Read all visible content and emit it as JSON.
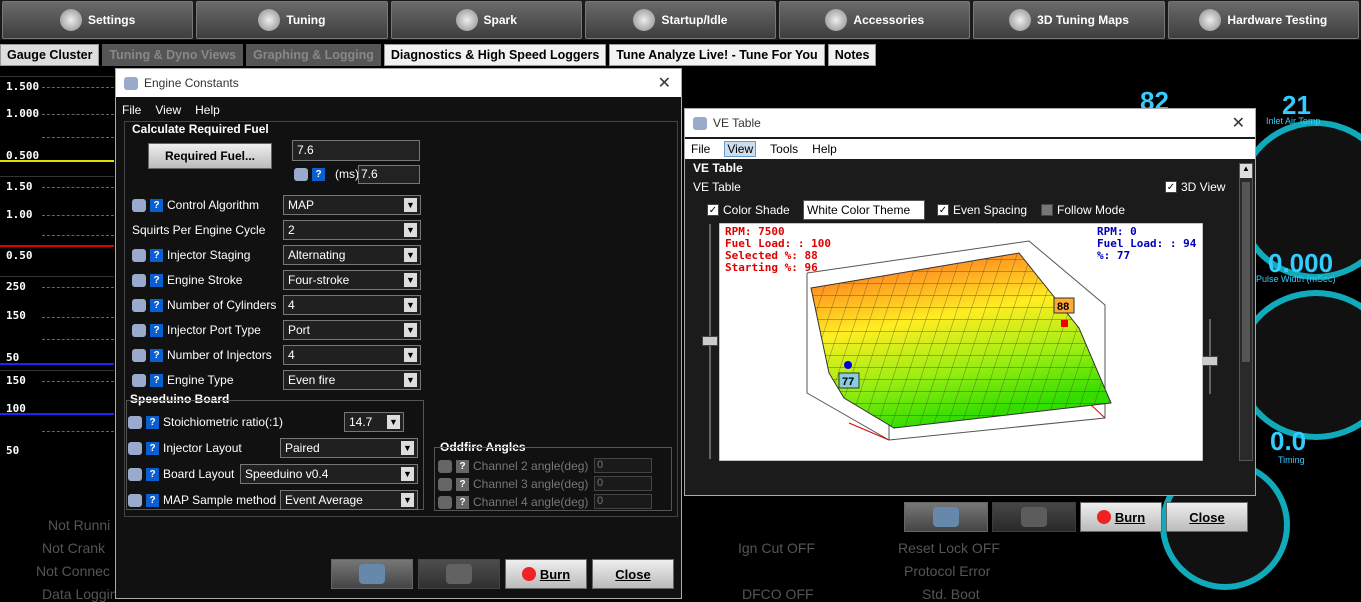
{
  "topbar": [
    {
      "label": "Settings",
      "icon": "gear-icon"
    },
    {
      "label": "Tuning",
      "icon": "wrench-icon"
    },
    {
      "label": "Spark",
      "icon": "spark-plug-icon"
    },
    {
      "label": "Startup/Idle",
      "icon": "startup-icon"
    },
    {
      "label": "Accessories",
      "icon": "tools-icon"
    },
    {
      "label": "3D Tuning Maps",
      "icon": "crossed-tools-icon"
    },
    {
      "label": "Hardware Testing",
      "icon": "hardware-icon"
    }
  ],
  "tabs": [
    "Gauge Cluster",
    "Tuning & Dyno Views",
    "Graphing & Logging",
    "Diagnostics & High Speed Loggers",
    "Tune Analyze Live! - Tune For You",
    "Notes"
  ],
  "history": [
    {
      "labels": [
        "1.500",
        "1.000",
        "0.500"
      ]
    },
    {
      "labels": [
        "1.50",
        "1.00",
        "0.50"
      ]
    },
    {
      "labels": [
        "250",
        "150",
        "50"
      ]
    },
    {
      "labels": [
        "150",
        "100",
        "50"
      ]
    }
  ],
  "status": [
    "Not Runni",
    "Not Crank",
    "Not Connec",
    "Data Loggin",
    "Ign Cut OFF",
    "Reset Lock OFF",
    "Protocol Error",
    "DFCO OFF",
    "Std. Boot"
  ],
  "gauges": {
    "g1": {
      "value": "82"
    },
    "g2": {
      "value": "21",
      "label": "Inlet Air Temp"
    },
    "g3": {
      "value": "0.000",
      "label": "Pulse Width (mSec)"
    },
    "g4": {
      "value": "0.0",
      "label": "Timing"
    }
  },
  "engine_constants": {
    "title": "Engine Constants",
    "menu": [
      "File",
      "View",
      "Help"
    ],
    "section_fuel": "Calculate Required Fuel",
    "required_fuel_button": "Required Fuel...",
    "required_fuel_value": "7.6",
    "ms_unit": "(ms)",
    "ms_value": "7.6",
    "rows": [
      {
        "label": "Control Algorithm",
        "value": "MAP"
      },
      {
        "label": "Squirts Per Engine Cycle",
        "value": "2"
      },
      {
        "label": "Injector Staging",
        "value": "Alternating"
      },
      {
        "label": "Engine Stroke",
        "value": "Four-stroke"
      },
      {
        "label": "Number of Cylinders",
        "value": "4"
      },
      {
        "label": "Injector Port Type",
        "value": "Port"
      },
      {
        "label": "Number of Injectors",
        "value": "4"
      },
      {
        "label": "Engine Type",
        "value": "Even fire"
      }
    ],
    "section_board": "Speeduino Board",
    "board_rows": [
      {
        "label": "Stoichiometric ratio(:1)",
        "value": "14.7"
      },
      {
        "label": "Injector Layout",
        "value": "Paired"
      },
      {
        "label": "Board Layout",
        "value": "Speeduino v0.4"
      },
      {
        "label": "MAP Sample method",
        "value": "Event Average"
      }
    ],
    "section_oddfire": "Oddfire Angles",
    "oddfire_rows": [
      {
        "label": "Channel 2 angle(deg)",
        "value": "0"
      },
      {
        "label": "Channel 3 angle(deg)",
        "value": "0"
      },
      {
        "label": "Channel 4 angle(deg)",
        "value": "0"
      }
    ],
    "burn": "Burn",
    "close": "Close"
  },
  "ve_table": {
    "title": "VE Table",
    "menu": [
      "File",
      "View",
      "Tools",
      "Help"
    ],
    "section": "VE Table",
    "sub": "VE Table",
    "view3d": "3D View",
    "color_shade": "Color Shade",
    "theme": "White Color Theme",
    "even_spacing": "Even Spacing",
    "follow_mode": "Follow Mode",
    "info_left": [
      "RPM: 7500",
      "Fuel Load: : 100",
      "Selected %: 88",
      "Starting %: 96"
    ],
    "info_right": [
      "RPM: 0",
      "Fuel Load: : 94",
      "%: 77"
    ],
    "marker_high": "88",
    "marker_low": "77",
    "burn": "Burn",
    "close": "Close"
  }
}
